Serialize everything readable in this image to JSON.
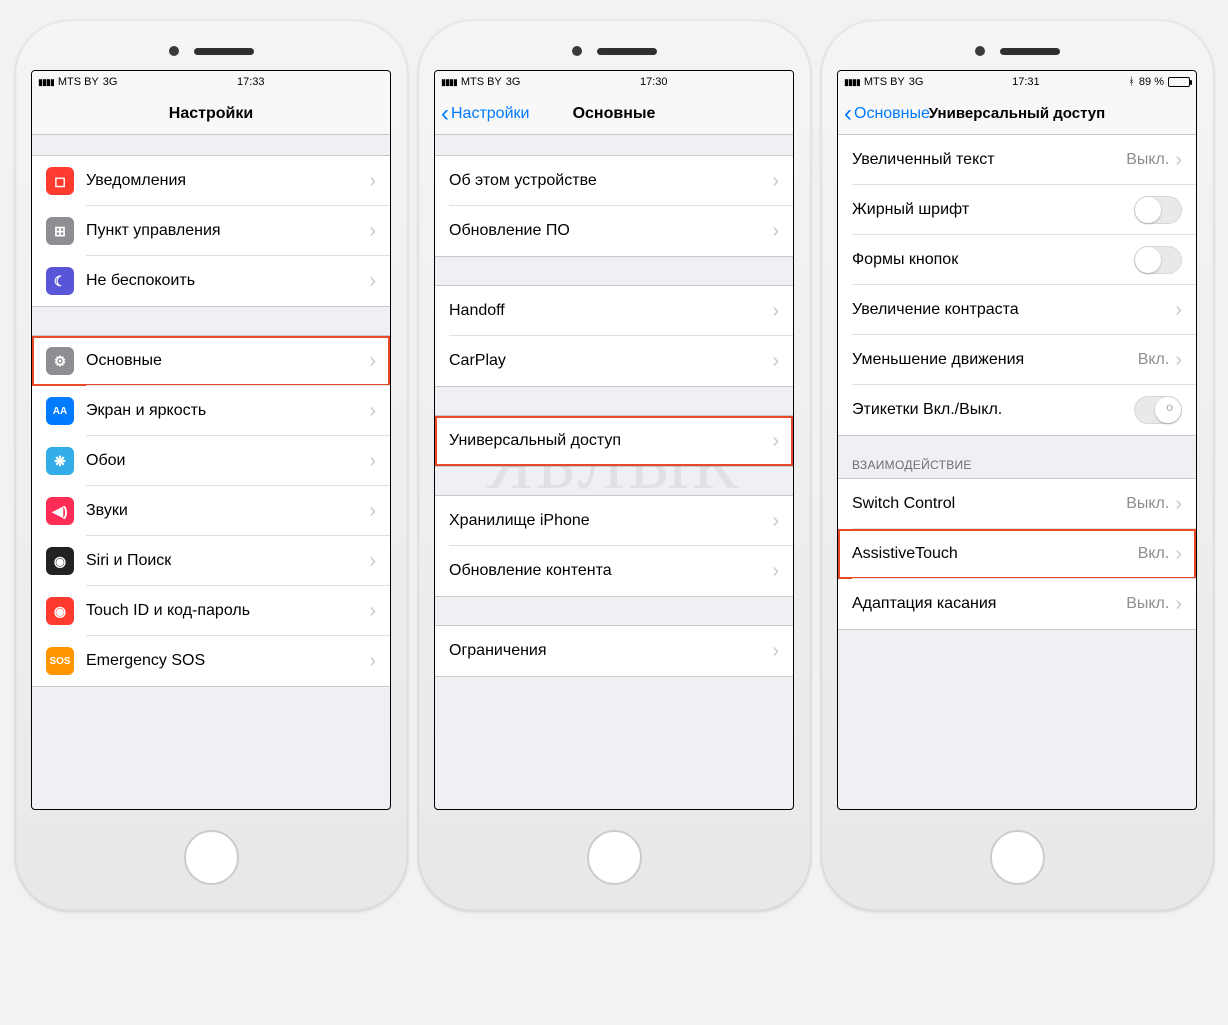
{
  "watermark": "ЯБЛЫК",
  "phone1": {
    "status": {
      "carrier": "MTS BY",
      "net": "3G",
      "time": "17:33"
    },
    "title": "Настройки",
    "group1": [
      {
        "icon": "bell-icon",
        "color": "#ff3b30",
        "label": "Уведомления"
      },
      {
        "icon": "control-icon",
        "color": "#8e8e93",
        "label": "Пункт управления"
      },
      {
        "icon": "moon-icon",
        "color": "#5856d6",
        "label": "Не беспокоить"
      }
    ],
    "group2": [
      {
        "icon": "gear-icon",
        "color": "#8e8e93",
        "label": "Основные",
        "highlight": true
      },
      {
        "icon": "aa-icon",
        "color": "#007aff",
        "label": "Экран и яркость"
      },
      {
        "icon": "flower-icon",
        "color": "#32ade6",
        "label": "Обои"
      },
      {
        "icon": "speaker-icon",
        "color": "#ff2d55",
        "label": "Звуки"
      },
      {
        "icon": "siri-icon",
        "color": "#222",
        "label": "Siri и Поиск"
      },
      {
        "icon": "touchid-icon",
        "color": "#ff3b30",
        "label": "Touch ID и код-пароль"
      },
      {
        "icon": "sos-icon",
        "color": "#ff9500",
        "label": "Emergency SOS"
      }
    ]
  },
  "phone2": {
    "status": {
      "carrier": "MTS BY",
      "net": "3G",
      "time": "17:30"
    },
    "back": "Настройки",
    "title": "Основные",
    "group1": [
      {
        "label": "Об этом устройстве"
      },
      {
        "label": "Обновление ПО"
      }
    ],
    "group2": [
      {
        "label": "Handoff"
      },
      {
        "label": "CarPlay"
      }
    ],
    "group3": [
      {
        "label": "Универсальный доступ",
        "highlight": true
      }
    ],
    "group4": [
      {
        "label": "Хранилище iPhone"
      },
      {
        "label": "Обновление контента"
      }
    ],
    "group5": [
      {
        "label": "Ограничения"
      }
    ]
  },
  "phone3": {
    "status": {
      "carrier": "MTS BY",
      "net": "3G",
      "time": "17:31",
      "battery": "89 %"
    },
    "back": "Основные",
    "title": "Универсальный доступ",
    "group1": [
      {
        "label": "Увеличенный текст",
        "value": "Выкл."
      },
      {
        "label": "Жирный шрифт",
        "toggle": false
      },
      {
        "label": "Формы кнопок",
        "toggle": false
      },
      {
        "label": "Увеличение контраста"
      },
      {
        "label": "Уменьшение движения",
        "value": "Вкл."
      },
      {
        "label": "Этикетки Вкл./Выкл.",
        "toggle_half": true
      }
    ],
    "section2_header": "ВЗАИМОДЕЙСТВИЕ",
    "group2": [
      {
        "label": "Switch Control",
        "value": "Выкл."
      },
      {
        "label": "AssistiveTouch",
        "value": "Вкл.",
        "highlight": true
      },
      {
        "label": "Адаптация касания",
        "value": "Выкл."
      }
    ]
  }
}
